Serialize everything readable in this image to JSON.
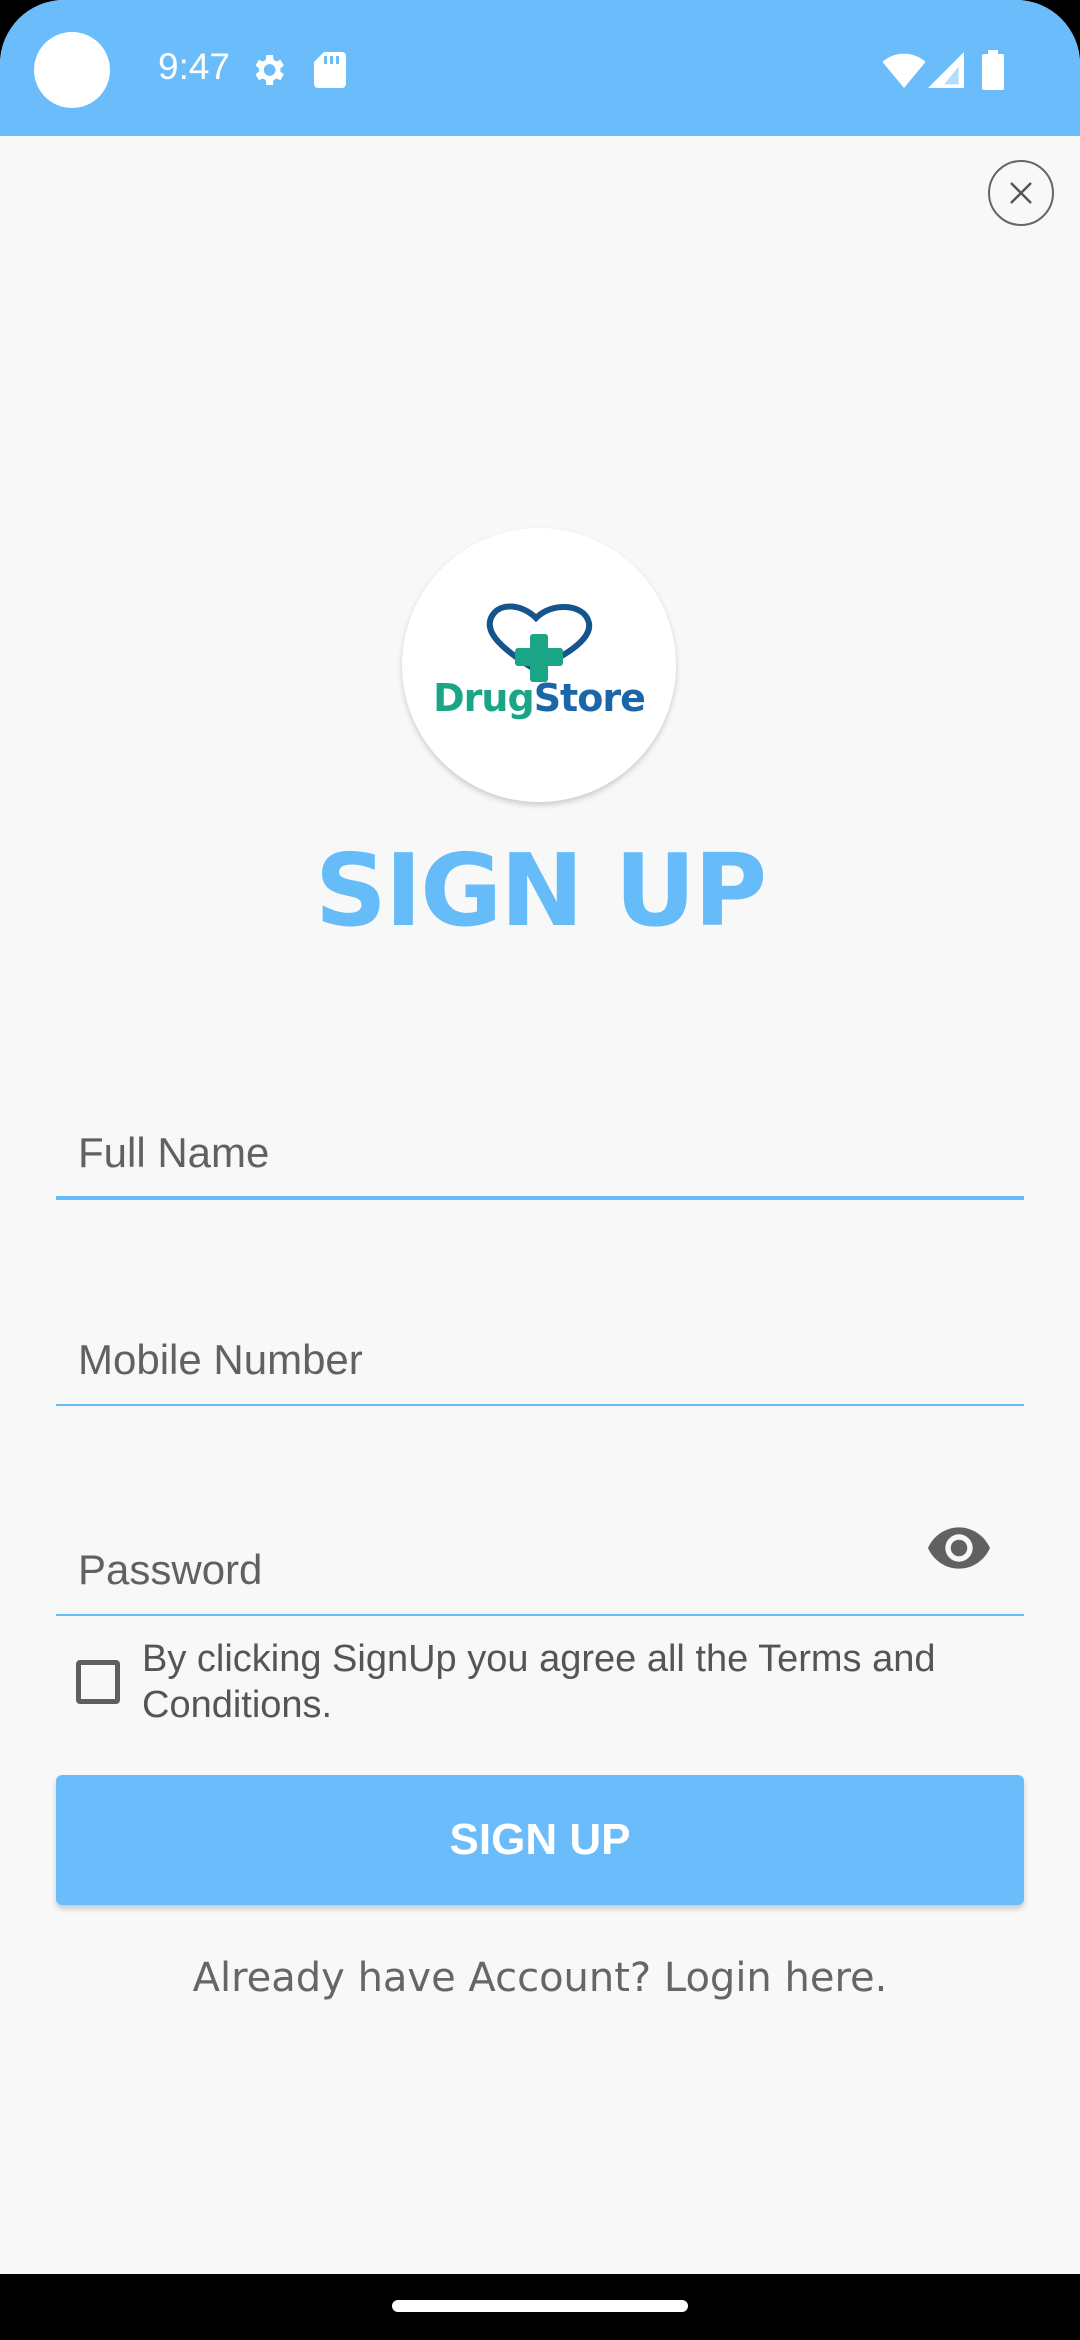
{
  "status_bar": {
    "time": "9:47",
    "icons": [
      "settings-icon",
      "sd-card-icon",
      "wifi-icon",
      "cell-signal-icon",
      "battery-icon"
    ],
    "background": "#6abcfa"
  },
  "logo": {
    "text_part1": "Drug",
    "text_part2": "Store"
  },
  "title": "SIGN UP",
  "form": {
    "full_name_placeholder": "Full Name",
    "mobile_placeholder": "Mobile Number",
    "password_placeholder": "Password",
    "terms_text": "By clicking SignUp you agree all the Terms and Conditions.",
    "terms_checked": false
  },
  "signup_button_label": "SIGN UP",
  "login_link": "Already have Account? Login here.",
  "colors": {
    "accent": "#66bcf8",
    "logo_green": "#1aa686",
    "logo_blue": "#1a66a8",
    "background": "#f8f8f8"
  }
}
